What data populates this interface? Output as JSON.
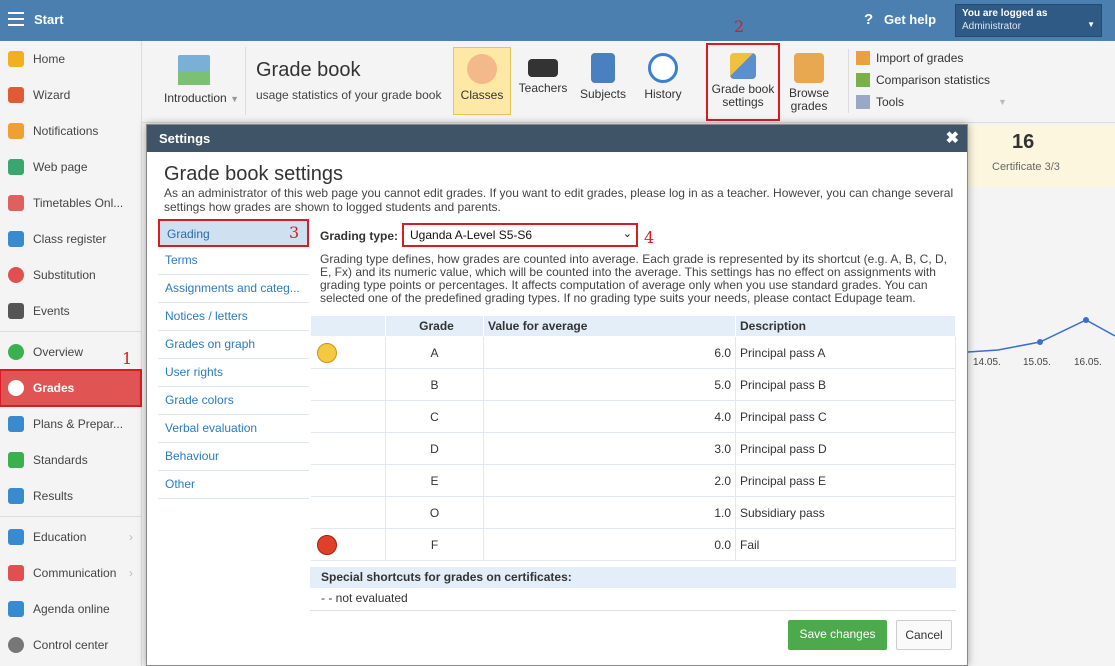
{
  "topbar": {
    "title": "Start",
    "help": "Get help",
    "logged_line1": "You are logged as",
    "logged_line2": "Administrator"
  },
  "sidebar": {
    "items": [
      {
        "label": "Home",
        "icon": "star-icon",
        "color": "#f2b01e"
      },
      {
        "label": "Wizard",
        "icon": "wand-icon",
        "color": "#e05b35"
      },
      {
        "label": "Notifications",
        "icon": "envelope-icon",
        "color": "#f0a030"
      },
      {
        "label": "Web page",
        "icon": "house-icon",
        "color": "#3aa76d"
      },
      {
        "label": "Timetables Onl...",
        "icon": "calendar-grid-icon",
        "color": "#e06060"
      },
      {
        "label": "Class register",
        "icon": "register-icon",
        "color": "#3a8ad0"
      },
      {
        "label": "Substitution",
        "icon": "person-icon",
        "color": "#e05050"
      },
      {
        "label": "Events",
        "icon": "calendar-icon",
        "color": "#555555"
      },
      {
        "label": "Overview",
        "icon": "check-circle-icon",
        "color": "#3ab050"
      },
      {
        "label": "Grades",
        "icon": "grade-icon",
        "color": "#ffffff"
      },
      {
        "label": "Plans & Prepar...",
        "icon": "plans-icon",
        "color": "#3a8ad0"
      },
      {
        "label": "Standards",
        "icon": "shield-check-icon",
        "color": "#3ab050"
      },
      {
        "label": "Results",
        "icon": "bar-chart-icon",
        "color": "#3a8ad0"
      },
      {
        "label": "Education",
        "icon": "book-icon",
        "color": "#3a8ad0"
      },
      {
        "label": "Communication",
        "icon": "chat-icon",
        "color": "#e05050"
      },
      {
        "label": "Agenda online",
        "icon": "pen-icon",
        "color": "#3a8ad0"
      },
      {
        "label": "Control center",
        "icon": "gear-icon",
        "color": "#777777"
      }
    ]
  },
  "toolbar": {
    "introduction": "Introduction",
    "title": "Grade book",
    "subtitle": "usage statistics of your grade book",
    "buttons": [
      "Classes",
      "Teachers",
      "Subjects",
      "History",
      "Grade book settings",
      "Browse grades"
    ],
    "side": [
      "Import of grades",
      "Comparison statistics",
      "Tools"
    ]
  },
  "background": {
    "big_number": "16",
    "certificate": "Certificate 3/3",
    "dates": [
      "14.05.",
      "15.05.",
      "16.05."
    ]
  },
  "modal": {
    "header": "Settings",
    "title": "Grade book settings",
    "description": "As an administrator of this web page you cannot edit grades. If you want to edit grades, please log in as a teacher. However, you can change several settings how grades are shown to logged students and parents.",
    "menu": [
      "Grading",
      "Terms",
      "Assignments and categ...",
      "Notices / letters",
      "Grades on graph",
      "User rights",
      "Grade colors",
      "Verbal evaluation",
      "Behaviour",
      "Other"
    ],
    "grading_type_label": "Grading type:",
    "grading_type_value": "Uganda A-Level S5-S6",
    "grading_desc": "Grading type defines, how grades are counted into average. Each grade is represented by its shortcut (e.g. A, B, C, D, E, Fx) and its numeric value, which will be counted into the average. This settings has no effect on assignments with grading type points or percentages. It affects computation of average only when you use standard grades. You can selected one of the predefined grading types. If no grading type suits your needs, please contact Edupage team.",
    "table_headers": [
      "",
      "Grade",
      "Value for average",
      "Description"
    ],
    "rows": [
      {
        "grade": "A",
        "value": "6.0",
        "desc": "Principal pass A",
        "face": "happy"
      },
      {
        "grade": "B",
        "value": "5.0",
        "desc": "Principal pass B",
        "face": ""
      },
      {
        "grade": "C",
        "value": "4.0",
        "desc": "Principal pass C",
        "face": ""
      },
      {
        "grade": "D",
        "value": "3.0",
        "desc": "Principal pass D",
        "face": ""
      },
      {
        "grade": "E",
        "value": "2.0",
        "desc": "Principal pass E",
        "face": ""
      },
      {
        "grade": "O",
        "value": "1.0",
        "desc": "Subsidiary pass",
        "face": ""
      },
      {
        "grade": "F",
        "value": "0.0",
        "desc": "Fail",
        "face": "angry"
      }
    ],
    "special_header": "Special shortcuts for grades on certificates:",
    "not_evaluated": "- - not evaluated",
    "save": "Save changes",
    "cancel": "Cancel"
  },
  "annotations": [
    "1",
    "2",
    "3",
    "4"
  ]
}
